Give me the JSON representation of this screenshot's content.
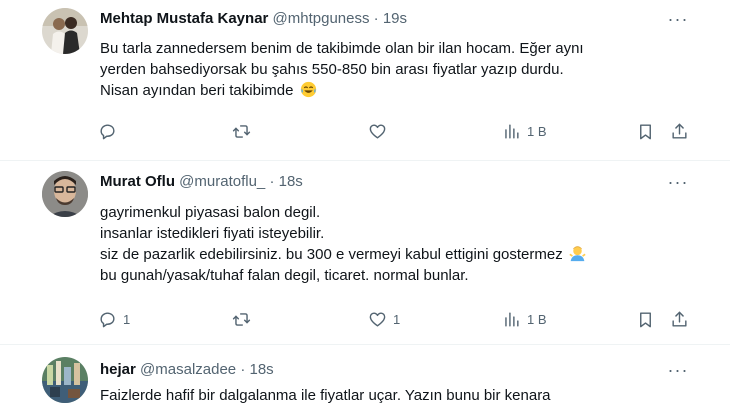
{
  "tweets": [
    {
      "name": "Mehtap Mustafa Kaynar",
      "handle": "@mhtpguness",
      "sep": "·",
      "time": "19s",
      "lines": [
        "Bu tarla zannedersem benim de takibimde olan  bir ilan hocam. Eğer aynı",
        "yerden bahsediyorsak bu şahıs 550-850 bin arası fiyatlar yazıp durdu.",
        "Nisan ayından beri takibimde"
      ],
      "replies": "",
      "retweets": "",
      "likes": "",
      "views": "1 B",
      "icons": [
        "reply-icon",
        "retweet-icon",
        "like-icon",
        "views-icon",
        "bookmark-icon",
        "share-icon"
      ]
    },
    {
      "name": "Murat Oflu",
      "handle": "@muratoflu_",
      "sep": "·",
      "time": "18s",
      "lines": [
        "gayrimenkul piyasasi balon degil.",
        "insanlar istedikleri fiyati isteyebilir.",
        "siz de pazarlik edebilirsiniz. bu 300 e vermeyi kabul ettigini gostermez",
        "bu gunah/yasak/tuhaf falan degil, ticaret. normal bunlar."
      ],
      "replies": "1",
      "retweets": "",
      "likes": "1",
      "views": "1 B"
    },
    {
      "name": "hejar",
      "handle": "@masalzadee",
      "sep": "·",
      "time": "18s",
      "lines": [
        "Faizlerde hafif bir dalgalanma ile fiyatlar uçar. Yazın bunu bir kenara"
      ]
    }
  ],
  "more_label": "···"
}
